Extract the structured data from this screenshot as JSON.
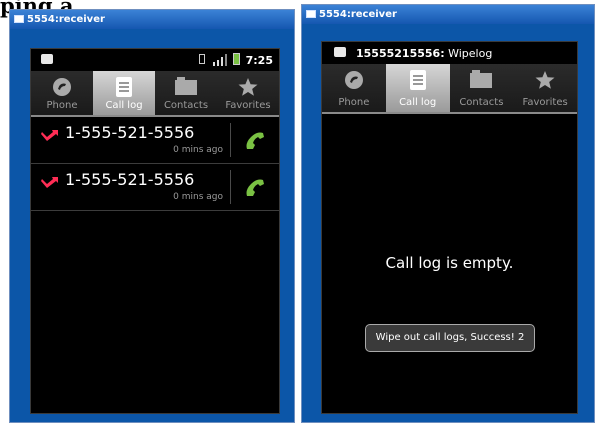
{
  "clipped_header": "ping a",
  "left": {
    "window_title": "5554:receiver",
    "status_time": "7:25",
    "tabs": [
      {
        "label": "Phone"
      },
      {
        "label": "Call log"
      },
      {
        "label": "Contacts"
      },
      {
        "label": "Favorites"
      }
    ],
    "calls": [
      {
        "number": "1-555-521-5556",
        "time": "0 mins ago"
      },
      {
        "number": "1-555-521-5556",
        "time": "0 mins ago"
      }
    ]
  },
  "right": {
    "window_title": "5554:receiver",
    "notification_sender": "15555215556:",
    "notification_text": " Wipelog",
    "tabs": [
      {
        "label": "Phone"
      },
      {
        "label": "Call log"
      },
      {
        "label": "Contacts"
      },
      {
        "label": "Favorites"
      }
    ],
    "empty_message": "Call log is empty.",
    "toast": "Wipe out call logs, Success!  2"
  },
  "colors": {
    "missed_call": "#ff2d55",
    "call_button": "#7ac143",
    "window_frame": "#0c56a8"
  }
}
